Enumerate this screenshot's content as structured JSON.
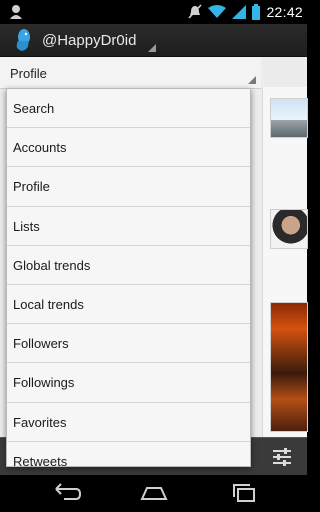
{
  "status_bar": {
    "time": "22:42",
    "icons": [
      "notification-icon",
      "mute-icon",
      "wifi-icon",
      "signal-icon",
      "battery-icon"
    ]
  },
  "action_bar": {
    "account_name": "@HappyDr0id",
    "app_icon": "bird-icon"
  },
  "section_spinner": {
    "selected": "Profile"
  },
  "dropdown": {
    "items": [
      "Search",
      "Accounts",
      "Profile",
      "Lists",
      "Global trends",
      "Local trends",
      "Followers",
      "Followings",
      "Favorites",
      "Retweets"
    ]
  },
  "bottom_toolbar": {
    "icon": "tune-icon"
  },
  "nav_bar": {
    "buttons": [
      "back-icon",
      "home-icon",
      "recents-icon"
    ]
  }
}
